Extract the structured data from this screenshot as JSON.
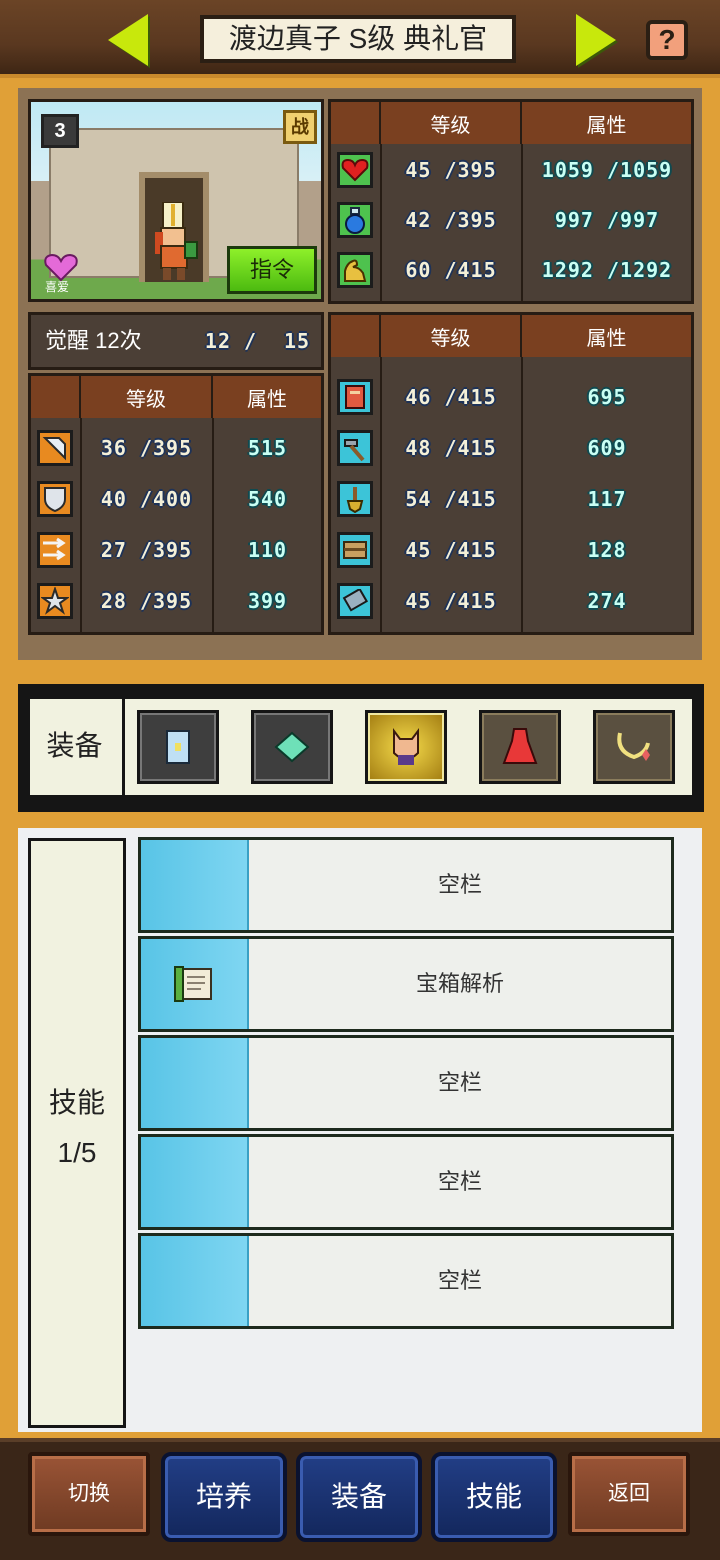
{
  "header": {
    "title": "渡边真子 S级 典礼官"
  },
  "portrait": {
    "rank": "3",
    "battle_badge": "战",
    "favor_label": "喜爱",
    "command_label": "指令"
  },
  "stats_top": {
    "col_level": "等级",
    "col_attr": "属性",
    "rows": [
      {
        "icon": "heart-icon",
        "level": "45 /395",
        "attr": "1059 /1059"
      },
      {
        "icon": "potion-icon",
        "level": "42 /395",
        "attr": "997 /997"
      },
      {
        "icon": "bicep-icon",
        "level": "60 /415",
        "attr": "1292 /1292"
      }
    ]
  },
  "awaken": {
    "label": "觉醒 12次",
    "count": "12 /",
    "max": "15"
  },
  "stats_left": {
    "col_level": "等级",
    "col_attr": "属性",
    "rows": [
      {
        "icon": "sword-icon",
        "level": "36 /395",
        "attr": "515"
      },
      {
        "icon": "shield-icon",
        "level": "40 /400",
        "attr": "540"
      },
      {
        "icon": "speed-arrows-icon",
        "level": "27 /395",
        "attr": "110"
      },
      {
        "icon": "star-icon",
        "level": "28 /395",
        "attr": "399"
      }
    ]
  },
  "stats_right": {
    "col_level": "等级",
    "col_attr": "属性",
    "rows": [
      {
        "icon": "book-icon",
        "level": "46 /415",
        "attr": "695"
      },
      {
        "icon": "hammer-icon",
        "level": "48 /415",
        "attr": "609"
      },
      {
        "icon": "shovel-icon",
        "level": "54 /415",
        "attr": "117"
      },
      {
        "icon": "chest-icon",
        "level": "45 /415",
        "attr": "128"
      },
      {
        "icon": "scroll-icon",
        "level": "45 /415",
        "attr": "274"
      }
    ]
  },
  "equipment": {
    "label": "装备",
    "slots": [
      {
        "icon": "book-item-icon"
      },
      {
        "icon": "gem-item-icon"
      },
      {
        "icon": "mask-item-icon"
      },
      {
        "icon": "dress-item-icon"
      },
      {
        "icon": "necklace-item-icon"
      }
    ]
  },
  "skills": {
    "label": "技能",
    "count": "1/5",
    "slots": [
      {
        "name": "空栏"
      },
      {
        "name": "宝箱解析"
      },
      {
        "name": "空栏"
      },
      {
        "name": "空栏"
      },
      {
        "name": "空栏"
      }
    ]
  },
  "bottom_nav": {
    "switch": "切换",
    "train": "培养",
    "equip": "装备",
    "skill": "技能",
    "back": "返回"
  }
}
